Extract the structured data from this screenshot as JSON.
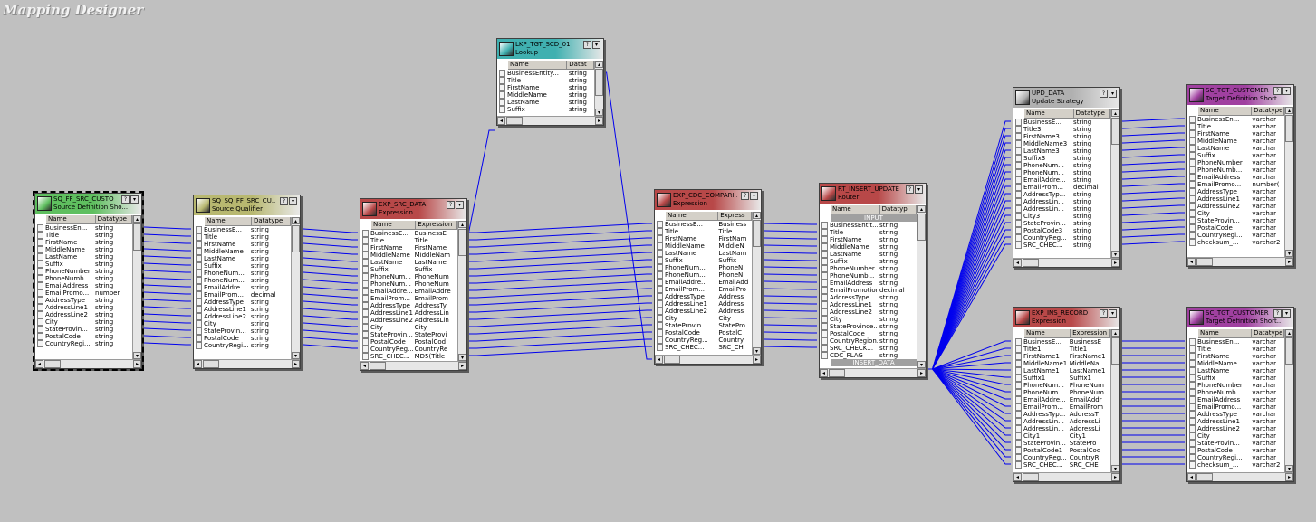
{
  "app": {
    "title": "Mapping Designer"
  },
  "transforms": {
    "src": {
      "name": "SQ_FF_SRC_CUSTO",
      "type": "Source Definition Sho...",
      "columns": [
        "Name",
        "Datatype"
      ],
      "rows": [
        [
          "BusinessEn...",
          "string"
        ],
        [
          "Title",
          "string"
        ],
        [
          "FirstName",
          "string"
        ],
        [
          "MiddleName",
          "string"
        ],
        [
          "LastName",
          "string"
        ],
        [
          "Suffix",
          "string"
        ],
        [
          "PhoneNumber",
          "string"
        ],
        [
          "PhoneNumb...",
          "string"
        ],
        [
          "EmailAddress",
          "string"
        ],
        [
          "EmailPromo...",
          "number"
        ],
        [
          "AddressType",
          "string"
        ],
        [
          "AddressLine1",
          "string"
        ],
        [
          "AddressLine2",
          "string"
        ],
        [
          "City",
          "string"
        ],
        [
          "StateProvin...",
          "string"
        ],
        [
          "PostalCode",
          "string"
        ],
        [
          "CountryRegi...",
          "string"
        ]
      ]
    },
    "sq": {
      "name": "SQ_SQ_FF_SRC_CU...",
      "type": "Source Qualifier",
      "columns": [
        "Name",
        "Datatype"
      ],
      "rows": [
        [
          "BusinessE...",
          "string"
        ],
        [
          "Title",
          "string"
        ],
        [
          "FirstName",
          "string"
        ],
        [
          "MiddleName",
          "string"
        ],
        [
          "LastName",
          "string"
        ],
        [
          "Suffix",
          "string"
        ],
        [
          "PhoneNum...",
          "string"
        ],
        [
          "PhoneNum...",
          "string"
        ],
        [
          "EmailAddre...",
          "string"
        ],
        [
          "EmailProm...",
          "decimal"
        ],
        [
          "AddressType",
          "string"
        ],
        [
          "AddressLine1",
          "string"
        ],
        [
          "AddressLine2",
          "string"
        ],
        [
          "City",
          "string"
        ],
        [
          "StateProvin...",
          "string"
        ],
        [
          "PostalCode",
          "string"
        ],
        [
          "CountryRegi...",
          "string"
        ]
      ]
    },
    "exp_src": {
      "name": "EXP_SRC_DATA",
      "type": "Expression",
      "columns": [
        "Name",
        "Expression"
      ],
      "rows": [
        [
          "BusinessE...",
          "BusinessE"
        ],
        [
          "Title",
          "Title"
        ],
        [
          "FirstName",
          "FirstName"
        ],
        [
          "MiddleName",
          "MiddleNam"
        ],
        [
          "LastName",
          "LastName"
        ],
        [
          "Suffix",
          "Suffix"
        ],
        [
          "PhoneNum...",
          "PhoneNum"
        ],
        [
          "PhoneNum...",
          "PhoneNum"
        ],
        [
          "EmailAddre...",
          "EmailAddre"
        ],
        [
          "EmailProm...",
          "EmailProm"
        ],
        [
          "AddressType",
          "AddressTy"
        ],
        [
          "AddressLine1",
          "AddressLin"
        ],
        [
          "AddressLine2",
          "AddressLin"
        ],
        [
          "City",
          "City"
        ],
        [
          "StateProvin...",
          "StateProvi"
        ],
        [
          "PostalCode",
          "PostalCod"
        ],
        [
          "CountryReg...",
          "CountryRe"
        ],
        [
          "SRC_CHEC...",
          "MD5(Title"
        ]
      ]
    },
    "lkp": {
      "name": "LKP_TGT_SCD_01",
      "type": "Lookup",
      "columns": [
        "Name",
        "Datat"
      ],
      "rows": [
        [
          "BusinessEntity...",
          "string"
        ],
        [
          "Title",
          "string"
        ],
        [
          "FirstName",
          "string"
        ],
        [
          "MiddleName",
          "string"
        ],
        [
          "LastName",
          "string"
        ],
        [
          "Suffix",
          "string"
        ],
        [
          "PhoneNumber",
          "string"
        ]
      ]
    },
    "exp_cdc": {
      "name": "EXP_CDC_COMPARI...",
      "type": "Expression",
      "columns": [
        "Name",
        "Express"
      ],
      "rows": [
        [
          "BusinessE...",
          "Business"
        ],
        [
          "Title",
          "Title"
        ],
        [
          "FirstName",
          "FirstNam"
        ],
        [
          "MiddleName",
          "MiddleN"
        ],
        [
          "LastName",
          "LastNam"
        ],
        [
          "Suffix",
          "Suffix"
        ],
        [
          "PhoneNum...",
          "PhoneN"
        ],
        [
          "PhoneNum...",
          "PhoneN"
        ],
        [
          "EmailAddre...",
          "EmailAdd"
        ],
        [
          "EmailProm...",
          "EmailPro"
        ],
        [
          "AddressType",
          "Address"
        ],
        [
          "AddressLine1",
          "Address"
        ],
        [
          "AddressLine2",
          "Address"
        ],
        [
          "City",
          "City"
        ],
        [
          "StateProvin...",
          "StatePro"
        ],
        [
          "PostalCode",
          "PostalC"
        ],
        [
          "CountryReg...",
          "Country"
        ],
        [
          "SRC_CHEC...",
          "SRC_CH"
        ],
        [
          "SRC_CHEC...",
          ""
        ]
      ]
    },
    "rtr": {
      "name": "RT_INSERT_UPDATE",
      "type": "Router",
      "columns": [
        "Name",
        "Datatyp"
      ],
      "group_top": "INPUT",
      "group_bottom": "INSERT_DATA",
      "rows": [
        [
          "BusinessEntit...",
          "string"
        ],
        [
          "Title",
          "string"
        ],
        [
          "FirstName",
          "string"
        ],
        [
          "MiddleName",
          "string"
        ],
        [
          "LastName",
          "string"
        ],
        [
          "Suffix",
          "string"
        ],
        [
          "PhoneNumber",
          "string"
        ],
        [
          "PhoneNumb...",
          "string"
        ],
        [
          "EmailAddress",
          "string"
        ],
        [
          "EmailPromotion",
          "decimal"
        ],
        [
          "AddressType",
          "string"
        ],
        [
          "AddressLine1",
          "string"
        ],
        [
          "AddressLine2",
          "string"
        ],
        [
          "City",
          "string"
        ],
        [
          "StateProvince...",
          "string"
        ],
        [
          "PostalCode",
          "string"
        ],
        [
          "CountryRegion...",
          "string"
        ],
        [
          "SRC_CHECK...",
          "string"
        ],
        [
          "CDC_FLAG",
          "string"
        ]
      ]
    },
    "upd": {
      "name": "UPD_DATA",
      "type": "Update Strategy",
      "columns": [
        "Name",
        "Datatype"
      ],
      "rows": [
        [
          "BusinessE...",
          "string"
        ],
        [
          "Title3",
          "string"
        ],
        [
          "FirstName3",
          "string"
        ],
        [
          "MiddleName3",
          "string"
        ],
        [
          "LastName3",
          "string"
        ],
        [
          "Suffix3",
          "string"
        ],
        [
          "PhoneNum...",
          "string"
        ],
        [
          "PhoneNum...",
          "string"
        ],
        [
          "EmailAddre...",
          "string"
        ],
        [
          "EmailProm...",
          "decimal"
        ],
        [
          "AddressTyp...",
          "string"
        ],
        [
          "AddressLin...",
          "string"
        ],
        [
          "AddressLin...",
          "string"
        ],
        [
          "City3",
          "string"
        ],
        [
          "StateProvin...",
          "string"
        ],
        [
          "PostalCode3",
          "string"
        ],
        [
          "CountryReg...",
          "string"
        ],
        [
          "SRC_CHEC...",
          "string"
        ]
      ]
    },
    "exp_ins": {
      "name": "EXP_INS_RECORD",
      "type": "Expression",
      "columns": [
        "Name",
        "Expression"
      ],
      "rows": [
        [
          "BusinessE...",
          "BusinessE"
        ],
        [
          "Title1",
          "Title1"
        ],
        [
          "FirstName1",
          "FirstName1"
        ],
        [
          "MiddleName1",
          "MiddleNa"
        ],
        [
          "LastName1",
          "LastName1"
        ],
        [
          "Suffix1",
          "Suffix1"
        ],
        [
          "PhoneNum...",
          "PhoneNum"
        ],
        [
          "PhoneNum...",
          "PhoneNum"
        ],
        [
          "EmailAddre...",
          "EmailAddr"
        ],
        [
          "EmailProm...",
          "EmailProm"
        ],
        [
          "AddressTyp...",
          "AddressT"
        ],
        [
          "AddressLin...",
          "AddressLi"
        ],
        [
          "AddressLin...",
          "AddressLi"
        ],
        [
          "City1",
          "City1"
        ],
        [
          "StateProvin...",
          "StatePro"
        ],
        [
          "PostalCode1",
          "PostalCod"
        ],
        [
          "CountryReg...",
          "CountryR"
        ],
        [
          "SRC_CHEC...",
          "SRC_CHE"
        ]
      ]
    },
    "tgt1": {
      "name": "SC_TGT_CUSTOMER",
      "type": "Target Definition Short...",
      "columns": [
        "Name",
        "Datatype"
      ],
      "rows": [
        [
          "BusinessEn...",
          "varchar"
        ],
        [
          "Title",
          "varchar"
        ],
        [
          "FirstName",
          "varchar"
        ],
        [
          "MiddleName",
          "varchar"
        ],
        [
          "LastName",
          "varchar"
        ],
        [
          "Suffix",
          "varchar"
        ],
        [
          "PhoneNumber",
          "varchar"
        ],
        [
          "PhoneNumb...",
          "varchar"
        ],
        [
          "EmailAddress",
          "varchar"
        ],
        [
          "EmailPromo...",
          "number("
        ],
        [
          "AddressType",
          "varchar"
        ],
        [
          "AddressLine1",
          "varchar"
        ],
        [
          "AddressLine2",
          "varchar"
        ],
        [
          "City",
          "varchar"
        ],
        [
          "StateProvin...",
          "varchar"
        ],
        [
          "PostalCode",
          "varchar"
        ],
        [
          "CountryRegi...",
          "varchar"
        ],
        [
          "checksum_...",
          "varchar2"
        ]
      ]
    },
    "tgt2": {
      "name": "SC_TGT_CUSTOMER",
      "type": "Target Definition Short...",
      "columns": [
        "Name",
        "Datatype"
      ],
      "rows": [
        [
          "BusinessEn...",
          "varchar"
        ],
        [
          "Title",
          "varchar"
        ],
        [
          "FirstName",
          "varchar"
        ],
        [
          "MiddleName",
          "varchar"
        ],
        [
          "LastName",
          "varchar"
        ],
        [
          "Suffix",
          "varchar"
        ],
        [
          "PhoneNumber",
          "varchar"
        ],
        [
          "PhoneNumb...",
          "varchar"
        ],
        [
          "EmailAddress",
          "varchar"
        ],
        [
          "EmailPromo...",
          "varchar"
        ],
        [
          "AddressType",
          "varchar"
        ],
        [
          "AddressLine1",
          "varchar"
        ],
        [
          "AddressLine2",
          "varchar"
        ],
        [
          "City",
          "varchar"
        ],
        [
          "StateProvin...",
          "varchar"
        ],
        [
          "PostalCode",
          "varchar"
        ],
        [
          "CountryRegi...",
          "varchar"
        ],
        [
          "checksum_...",
          "varchar2"
        ]
      ]
    }
  },
  "colors": {
    "canvas": "#c0c0c0",
    "link": "#0000ee",
    "source_header": "#5fbf5f",
    "qualifier_header": "#b8b870",
    "expression_header": "#b84848",
    "lookup_header": "#40b0b0",
    "router_header": "#b84848",
    "update_header": "#b0b0b0",
    "target_header": "#a040a0"
  },
  "icons": {
    "source": "source-definition-icon",
    "qualifier": "source-qualifier-icon",
    "expression": "expression-icon",
    "lookup": "lookup-icon",
    "router": "router-icon",
    "update": "update-strategy-icon",
    "target": "target-definition-icon"
  }
}
